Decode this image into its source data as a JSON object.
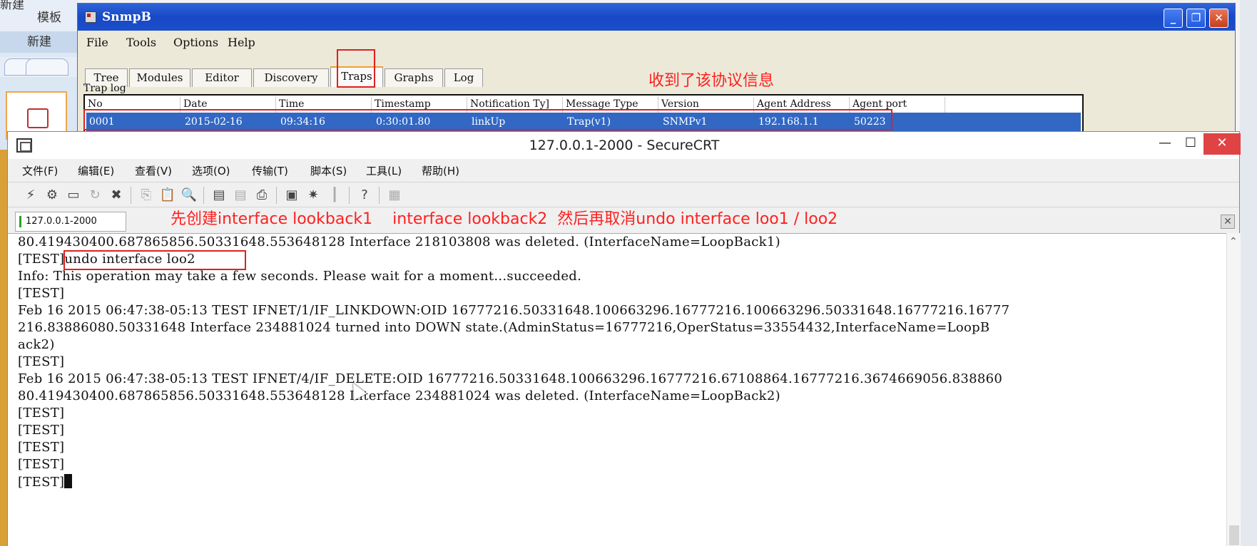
{
  "background_app": {
    "label_new_small": "新建",
    "label_template": "模板",
    "label_new": "新建"
  },
  "snmpb": {
    "title": "SnmpB",
    "menu": [
      "File",
      "Tools",
      "Options",
      "Help"
    ],
    "tabs": [
      "Tree",
      "Modules",
      "Editor",
      "Discovery",
      "Traps",
      "Graphs",
      "Log"
    ],
    "active_tab": "Traps",
    "trap_log_label": "Trap log",
    "columns": [
      "No",
      "Date",
      "Time",
      "Timestamp",
      "Notification Ty]",
      "Message Type",
      "Version",
      "Agent Address",
      "Agent port"
    ],
    "row": [
      "0001",
      "2015-02-16",
      "09:34:16",
      "0:30:01.80",
      "linkUp",
      "Trap(v1)",
      "SNMPv1",
      "192.168.1.1",
      "50223"
    ],
    "annotation": "收到了该协议信息",
    "btn_min": "_",
    "btn_max": "❐",
    "btn_close": "✕"
  },
  "securecrt": {
    "title": "127.0.0.1-2000 - SecureCRT",
    "btn_min": "—",
    "btn_max": "☐",
    "btn_close": "✕",
    "menu": [
      "文件(F)",
      "编辑(E)",
      "查看(V)",
      "选项(O)",
      "传输(T)",
      "脚本(S)",
      "工具(L)",
      "帮助(H)"
    ],
    "session_tab": "127.0.0.1-2000",
    "annotation": "先创建interface lookback1    interface lookback2  然后再取消undo interface loo1 / loo2",
    "tab_close": "✕",
    "terminal_lines": [
      "80.419430400.687865856.50331648.553648128 Interface 218103808 was deleted. (InterfaceName=LoopBack1)",
      "[TEST]undo interface loo2",
      "Info: This operation may take a few seconds. Please wait for a moment...succeeded.",
      "[TEST]",
      "Feb 16 2015 06:47:38-05:13 TEST IFNET/1/IF_LINKDOWN:OID 16777216.50331648.100663296.16777216.100663296.50331648.16777216.16777",
      "216.83886080.50331648 Interface 234881024 turned into DOWN state.(AdminStatus=16777216,OperStatus=33554432,InterfaceName=LoopB",
      "ack2)",
      "[TEST]",
      "Feb 16 2015 06:47:38-05:13 TEST IFNET/4/IF_DELETE:OID 16777216.50331648.100663296.16777216.67108864.16777216.3674669056.838860",
      "80.419430400.687865856.50331648.553648128 Interface 234881024 was deleted. (InterfaceName=LoopBack2)",
      "[TEST]",
      "[TEST]",
      "[TEST]",
      "[TEST]",
      "[TEST]"
    ]
  }
}
